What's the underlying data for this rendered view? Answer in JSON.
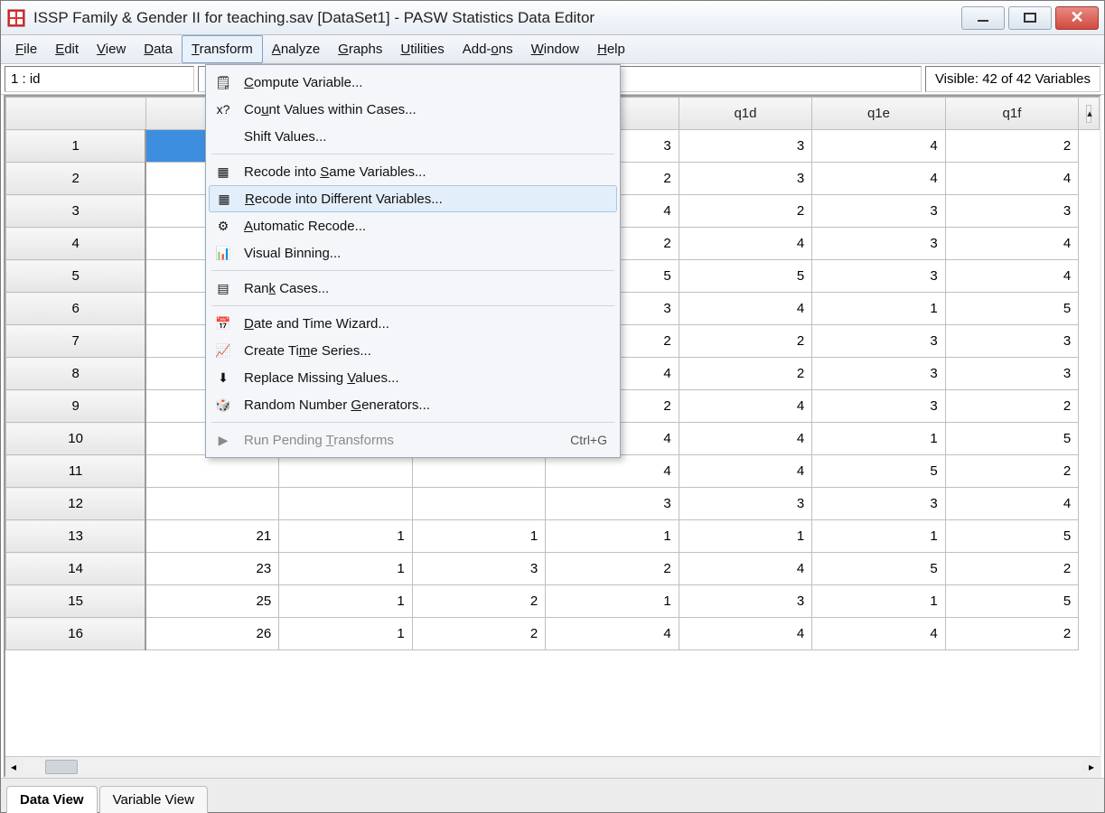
{
  "title": "ISSP Family & Gender II for teaching.sav [DataSet1] - PASW Statistics Data Editor",
  "menubar": {
    "file": "File",
    "edit": "Edit",
    "view": "View",
    "data": "Data",
    "transform": "Transform",
    "analyze": "Analyze",
    "graphs": "Graphs",
    "utilities": "Utilities",
    "addons": "Add-ons",
    "window": "Window",
    "help": "Help"
  },
  "cellref": "1 : id",
  "visible": "Visible: 42 of 42 Variables",
  "columns": {
    "c1": "",
    "c2": "",
    "c3": "",
    "c4": "",
    "q1d": "q1d",
    "q1e": "q1e",
    "q1f": "q1f"
  },
  "rows": [
    {
      "n": "1",
      "c1": "",
      "c2": "",
      "c3": "",
      "c4": "3",
      "q1d": "3",
      "q1e": "4",
      "q1f": "2"
    },
    {
      "n": "2",
      "c1": "",
      "c2": "",
      "c3": "",
      "c4": "2",
      "q1d": "3",
      "q1e": "4",
      "q1f": "4"
    },
    {
      "n": "3",
      "c1": "",
      "c2": "",
      "c3": "",
      "c4": "4",
      "q1d": "2",
      "q1e": "3",
      "q1f": "3"
    },
    {
      "n": "4",
      "c1": "",
      "c2": "",
      "c3": "",
      "c4": "2",
      "q1d": "4",
      "q1e": "3",
      "q1f": "4"
    },
    {
      "n": "5",
      "c1": "",
      "c2": "",
      "c3": "",
      "c4": "5",
      "q1d": "5",
      "q1e": "3",
      "q1f": "4"
    },
    {
      "n": "6",
      "c1": "",
      "c2": "",
      "c3": "",
      "c4": "3",
      "q1d": "4",
      "q1e": "1",
      "q1f": "5"
    },
    {
      "n": "7",
      "c1": "",
      "c2": "",
      "c3": "",
      "c4": "2",
      "q1d": "2",
      "q1e": "3",
      "q1f": "3"
    },
    {
      "n": "8",
      "c1": "",
      "c2": "",
      "c3": "",
      "c4": "4",
      "q1d": "2",
      "q1e": "3",
      "q1f": "3"
    },
    {
      "n": "9",
      "c1": "",
      "c2": "",
      "c3": "",
      "c4": "2",
      "q1d": "4",
      "q1e": "3",
      "q1f": "2"
    },
    {
      "n": "10",
      "c1": "",
      "c2": "",
      "c3": "",
      "c4": "4",
      "q1d": "4",
      "q1e": "1",
      "q1f": "5"
    },
    {
      "n": "11",
      "c1": "",
      "c2": "",
      "c3": "",
      "c4": "4",
      "q1d": "4",
      "q1e": "5",
      "q1f": "2"
    },
    {
      "n": "12",
      "c1": "",
      "c2": "",
      "c3": "",
      "c4": "3",
      "q1d": "3",
      "q1e": "3",
      "q1f": "4"
    },
    {
      "n": "13",
      "c1": "21",
      "c2": "1",
      "c3": "1",
      "c4": "1",
      "q1d": "1",
      "q1e": "1",
      "q1f": "5"
    },
    {
      "n": "14",
      "c1": "23",
      "c2": "1",
      "c3": "3",
      "c4": "2",
      "q1d": "4",
      "q1e": "5",
      "q1f": "2"
    },
    {
      "n": "15",
      "c1": "25",
      "c2": "1",
      "c3": "2",
      "c4": "1",
      "q1d": "3",
      "q1e": "1",
      "q1f": "5"
    },
    {
      "n": "16",
      "c1": "26",
      "c2": "1",
      "c3": "2",
      "c4": "4",
      "q1d": "4",
      "q1e": "4",
      "q1f": "2"
    }
  ],
  "dropdown": {
    "compute": "Compute Variable...",
    "count": "Count Values within Cases...",
    "shift": "Shift Values...",
    "recode_same": "Recode into Same Variables...",
    "recode_diff": "Recode into Different Variables...",
    "auto_recode": "Automatic Recode...",
    "vis_bin": "Visual Binning...",
    "rank": "Rank Cases...",
    "date_wizard": "Date and Time Wizard...",
    "time_series": "Create Time Series...",
    "replace_missing": "Replace Missing Values...",
    "rng": "Random Number Generators...",
    "run_pending": "Run Pending Transforms",
    "run_pending_shortcut": "Ctrl+G"
  },
  "tabs": {
    "data_view": "Data View",
    "variable_view": "Variable View"
  }
}
